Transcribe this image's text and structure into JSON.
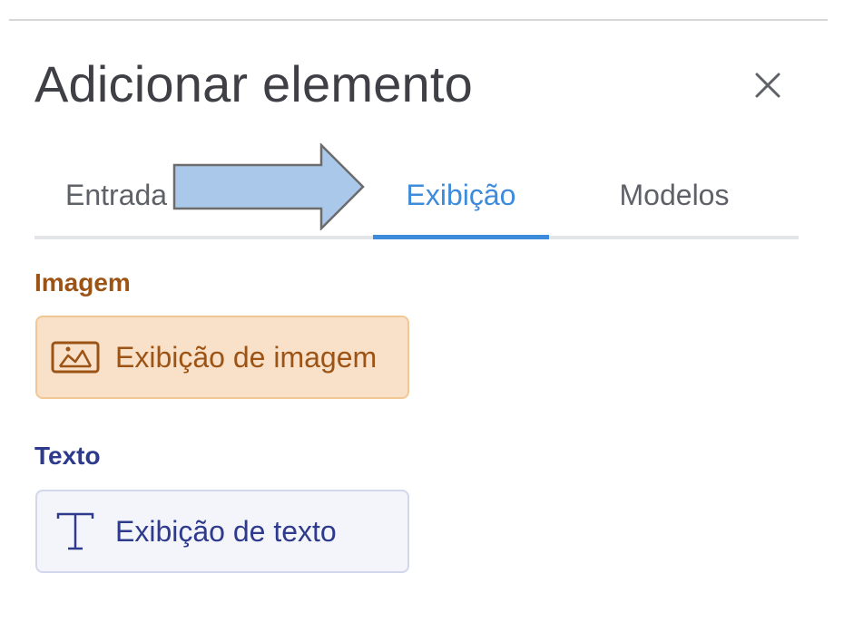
{
  "dialog": {
    "title": "Adicionar elemento",
    "close_icon": "close-icon"
  },
  "tabs": [
    {
      "label": "Entrada",
      "active": false
    },
    {
      "label": "Exibição",
      "active": true
    },
    {
      "label": "Modelos",
      "active": false
    }
  ],
  "annotation": {
    "arrow_icon": "right-arrow-icon",
    "arrow_color": "#a9c8ea"
  },
  "sections": [
    {
      "heading": "Imagem",
      "color": "#9c5416",
      "items": [
        {
          "label": "Exibição de imagem",
          "icon": "image-icon"
        }
      ]
    },
    {
      "heading": "Texto",
      "color": "#2e3a8c",
      "items": [
        {
          "label": "Exibição de texto",
          "icon": "text-icon"
        }
      ]
    }
  ],
  "colors": {
    "active_tab": "#3d8bdb",
    "image_card_bg": "#f9e1c9",
    "text_card_bg": "#f4f5fb"
  }
}
